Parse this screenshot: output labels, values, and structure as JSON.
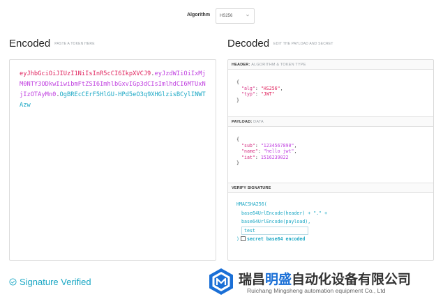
{
  "algorithm": {
    "label": "Algorithm",
    "selected": "HS256"
  },
  "encoded": {
    "title": "Encoded",
    "subtitle": "PASTE A TOKEN HERE",
    "token_header": "eyJhbGciOiJIUzI1NiIsInR5cCI6IkpXVCJ9",
    "token_payload": "eyJzdWIiOiIxMjM0NTY3ODkwIiwibmFtZSI6ImhlbGxvIGp3dCIsImlhdCI6MTUxNjIzOTAyMn0",
    "token_signature": "OgBREcCErF5HlGU-HPd5eO3q9XHGlzisBCylINWTAzw",
    "dot": "."
  },
  "decoded": {
    "title": "Decoded",
    "subtitle": "EDIT THE PAYLOAD AND SECRET",
    "header_panel": {
      "label": "HEADER:",
      "desc": "ALGORITHM & TOKEN TYPE",
      "alg_key": "\"alg\"",
      "alg_val": "\"HS256\"",
      "typ_key": "\"typ\"",
      "typ_val": "\"JWT\""
    },
    "payload_panel": {
      "label": "PAYLOAD:",
      "desc": "DATA",
      "sub_key": "\"sub\"",
      "sub_val": "\"1234567890\"",
      "name_key": "\"name\"",
      "name_val": "\"hello jwt\"",
      "iat_key": "\"iat\"",
      "iat_val": "1516239022"
    },
    "verify_panel": {
      "label": "VERIFY SIGNATURE",
      "fn": "HMACSHA256(",
      "line1": "base64UrlEncode(header) + \".\" +",
      "line2": "base64UrlEncode(payload),",
      "secret_value": "test",
      "close": ")",
      "b64_label": "secret base64 encoded"
    }
  },
  "status": {
    "text": "Signature Verified"
  },
  "watermark": {
    "cn_part1": "瑞昌",
    "cn_highlight": "明盛",
    "cn_part2": "自动化设备有限公司",
    "en": "Ruichang Mingsheng automation equipment Co., Ltd"
  },
  "colors": {
    "header": "#e0245e",
    "payload": "#c040e0",
    "signature": "#1aa7c4",
    "brand_blue": "#1a6fd6"
  }
}
